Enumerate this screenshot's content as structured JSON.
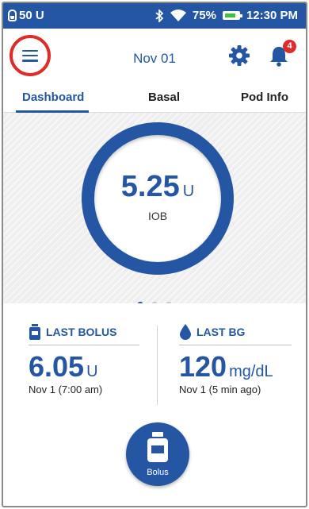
{
  "status_bar": {
    "pod_insulin": "50 U",
    "battery_percent": "75%",
    "battery_level": 0.75,
    "time": "12:30 PM",
    "icons": [
      "pod-icon",
      "bluetooth-icon",
      "wifi-icon",
      "battery-icon"
    ]
  },
  "header": {
    "date": "Nov 01",
    "notification_count": "4",
    "icons": [
      "menu-icon",
      "gear-icon",
      "bell-icon"
    ]
  },
  "tabs": [
    {
      "label": "Dashboard",
      "active": true
    },
    {
      "label": "Basal",
      "active": false
    },
    {
      "label": "Pod Info",
      "active": false
    }
  ],
  "iob": {
    "value": "5.25",
    "unit": "U",
    "label": "IOB"
  },
  "pager": {
    "count": 3,
    "active_index": 0
  },
  "last_bolus": {
    "title": "LAST BOLUS",
    "value": "6.05",
    "unit": "U",
    "detail": "Nov 1 (7:00 am)"
  },
  "last_bg": {
    "title": "LAST BG",
    "value": "120",
    "unit": "mg/dL",
    "detail": "Nov 1 (5 min ago)"
  },
  "bolus_button": {
    "label": "Bolus"
  },
  "colors": {
    "brand_blue": "#2456a4",
    "alert_red": "#e02b2b",
    "battery_green": "#3fbf3f"
  }
}
